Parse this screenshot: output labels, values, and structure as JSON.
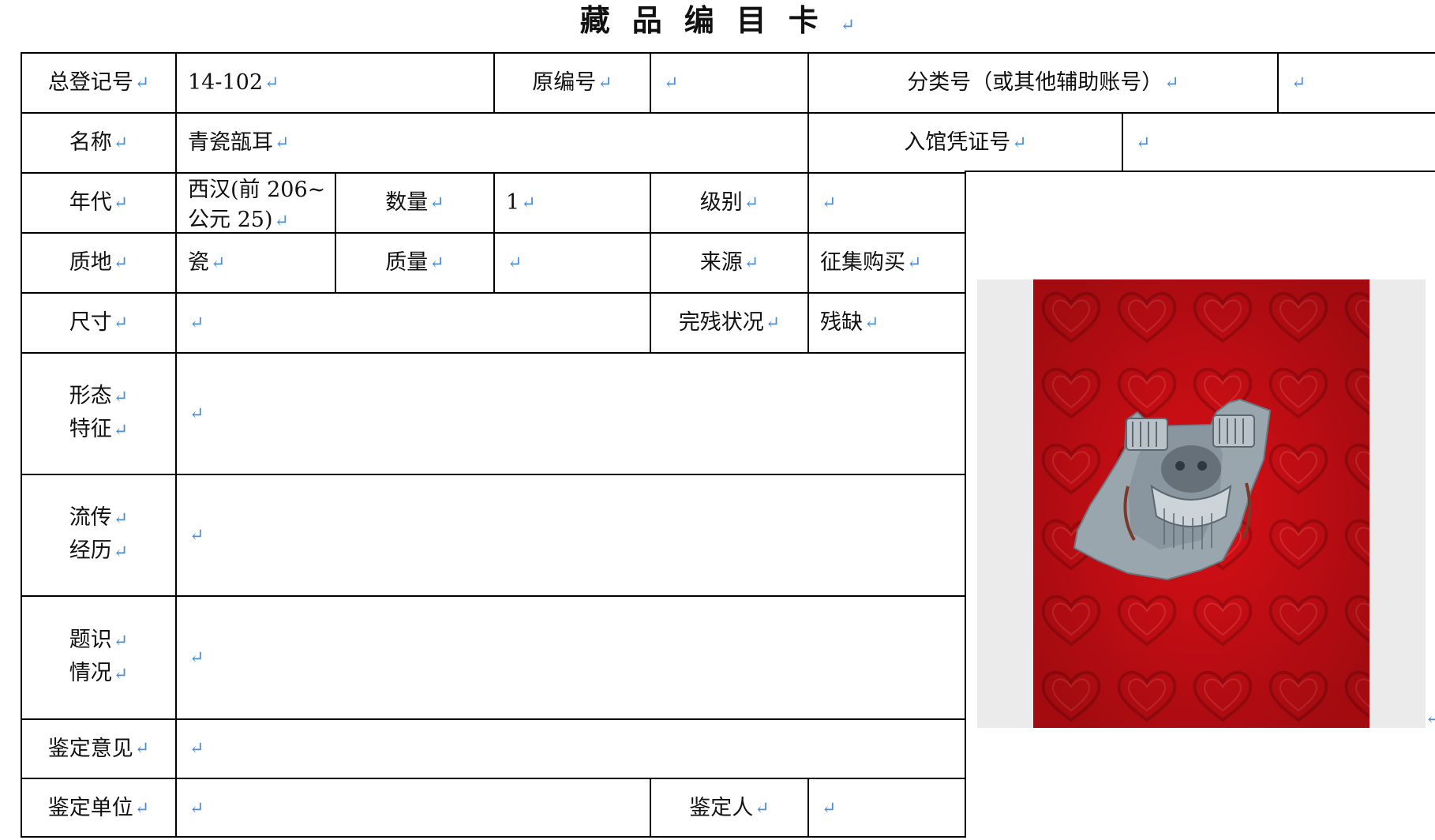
{
  "title": "藏品编目卡",
  "para_mark": "↵",
  "colors": {
    "para_mark": "#4a8fd6",
    "photo_background": "#d90f16"
  },
  "rows": {
    "r1": {
      "reg_no_label": "总登记号",
      "reg_no_value": "14-102",
      "orig_no_label": "原编号",
      "orig_no_value": "",
      "class_no_label": "分类号（或其他辅助账号）",
      "class_no_value": ""
    },
    "r2": {
      "name_label": "名称",
      "name_value": "青瓷瓿耳",
      "entry_label": "入馆凭证号",
      "entry_value": ""
    },
    "r3": {
      "era_label": "年代",
      "era_value_line1": "西汉(前 206~",
      "era_value_line2": "公元 25)",
      "qty_label": "数量",
      "qty_value": "1",
      "level_label": "级别",
      "level_value": ""
    },
    "r4": {
      "material_label": "质地",
      "material_value": "瓷",
      "mass_label": "质量",
      "mass_value": "",
      "source_label": "来源",
      "source_value": "征集购买"
    },
    "r5": {
      "size_label": "尺寸",
      "size_value": "",
      "condition_label": "完残状况",
      "condition_value": "残缺"
    },
    "r6": {
      "form_label_1": "形态",
      "form_label_2": "特征",
      "form_value": ""
    },
    "r7": {
      "history_label_1": "流传",
      "history_label_2": "经历",
      "history_value": ""
    },
    "r8": {
      "inscription_label_1": "题识",
      "inscription_label_2": "情况",
      "inscription_value": ""
    },
    "r9": {
      "opinion_label": "鉴定意见",
      "opinion_value": ""
    },
    "r10": {
      "unit_label": "鉴定单位",
      "unit_value": "",
      "appraiser_label": "鉴定人",
      "appraiser_value": ""
    }
  },
  "photo": {
    "icon": "artifact-photo"
  }
}
